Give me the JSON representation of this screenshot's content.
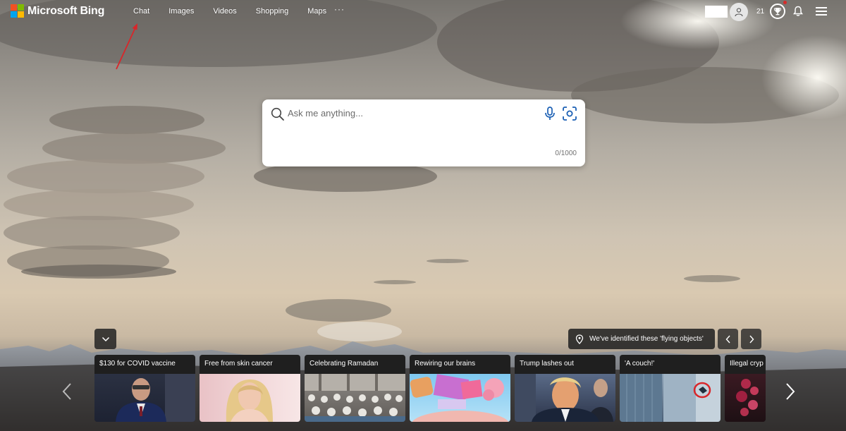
{
  "header": {
    "logo_text": "Microsoft Bing",
    "logo_colors": [
      "#f25022",
      "#7fba00",
      "#00a4ef",
      "#ffb900"
    ],
    "nav": [
      {
        "label": "Chat"
      },
      {
        "label": "Images"
      },
      {
        "label": "Videos"
      },
      {
        "label": "Shopping"
      },
      {
        "label": "Maps"
      }
    ],
    "more_label": "···",
    "rewards_points": "21"
  },
  "search": {
    "placeholder": "Ask me anything...",
    "char_count": "0/1000"
  },
  "info_bar": {
    "text": "We've identified these 'flying objects'"
  },
  "cards": [
    {
      "title": "$130 for COVID vaccine"
    },
    {
      "title": "Free from skin cancer"
    },
    {
      "title": "Celebrating Ramadan"
    },
    {
      "title": "Rewiring our brains"
    },
    {
      "title": "Trump lashes out"
    },
    {
      "title": "'A couch!'"
    },
    {
      "title": "Illegal cryp"
    }
  ],
  "annotation_color": "#d9262a"
}
